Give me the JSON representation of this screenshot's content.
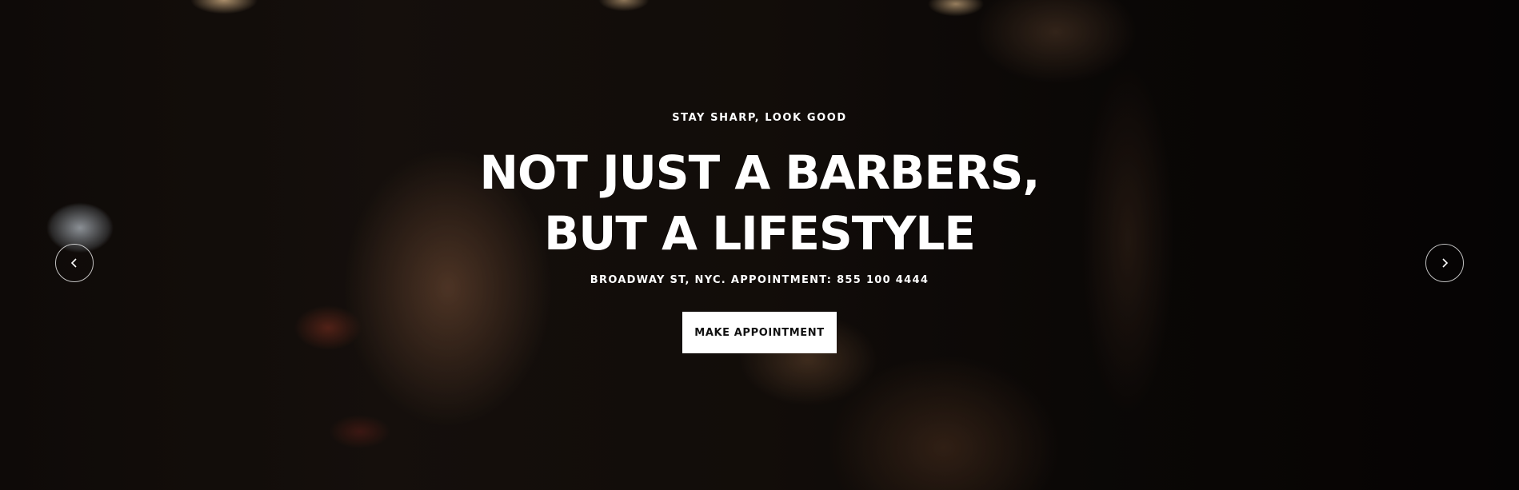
{
  "hero": {
    "eyebrow": "STAY SHARP, LOOK GOOD",
    "headline_line1": "NOT JUST A BARBERS,",
    "headline_line2": "BUT A LIFESTYLE",
    "address": "BROADWAY ST, NYC. APPOINTMENT: 855 100 4444",
    "cta_label": "MAKE APPOINTMENT"
  },
  "slider": {
    "prev_icon": "chevron-left-icon",
    "next_icon": "chevron-right-icon"
  },
  "colors": {
    "text": "#ffffff",
    "button_bg": "#ffffff",
    "button_text": "#111111"
  }
}
